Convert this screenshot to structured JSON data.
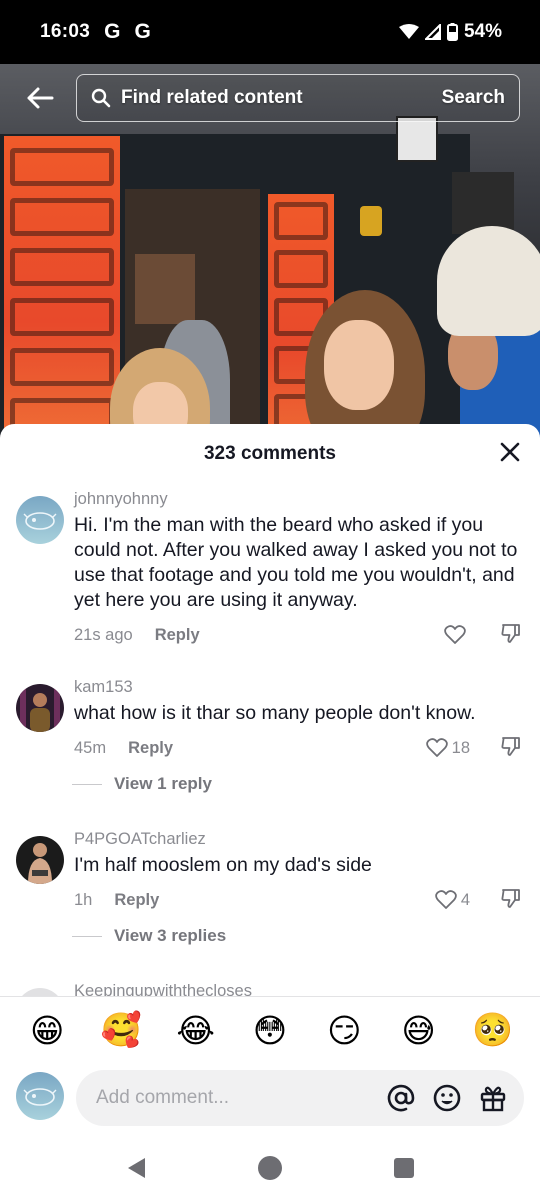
{
  "status_bar": {
    "time": "16:03",
    "google_icons": [
      "G",
      "G"
    ],
    "battery": "54%"
  },
  "search_bar": {
    "placeholder": "Find related content",
    "search_label": "Search"
  },
  "comments_panel": {
    "title": "323 comments",
    "comments": [
      {
        "username": "johnnyohnny",
        "text": "Hi. I'm the man with the beard who asked if you could not. After you walked away I asked you not to use that footage and you told me you wouldn't, and yet here you are using it anyway.",
        "time": "21s ago",
        "reply_label": "Reply",
        "likes": ""
      },
      {
        "username": "kam153",
        "text": "what how is it thar so many people don't know.",
        "time": "45m",
        "reply_label": "Reply",
        "likes": "18",
        "view_replies": "View 1 reply"
      },
      {
        "username": "P4PGOATcharliez",
        "text": "I'm half mooslem on my dad's side",
        "time": "1h",
        "reply_label": "Reply",
        "likes": "4",
        "view_replies": "View 3 replies"
      },
      {
        "username": "Keepingupwiththecloses"
      }
    ]
  },
  "emoji_bar": [
    "😁",
    "🥰",
    "😂",
    "😳",
    "😏",
    "😅",
    "🥺"
  ],
  "comment_input": {
    "placeholder": "Add comment..."
  },
  "icons": {
    "back": "arrow-left-icon",
    "search": "magnifier-icon",
    "close": "close-icon",
    "like": "heart-icon",
    "dislike": "thumbs-down-icon",
    "mention": "at-icon",
    "emoji": "smiley-icon",
    "gift": "gift-icon"
  }
}
